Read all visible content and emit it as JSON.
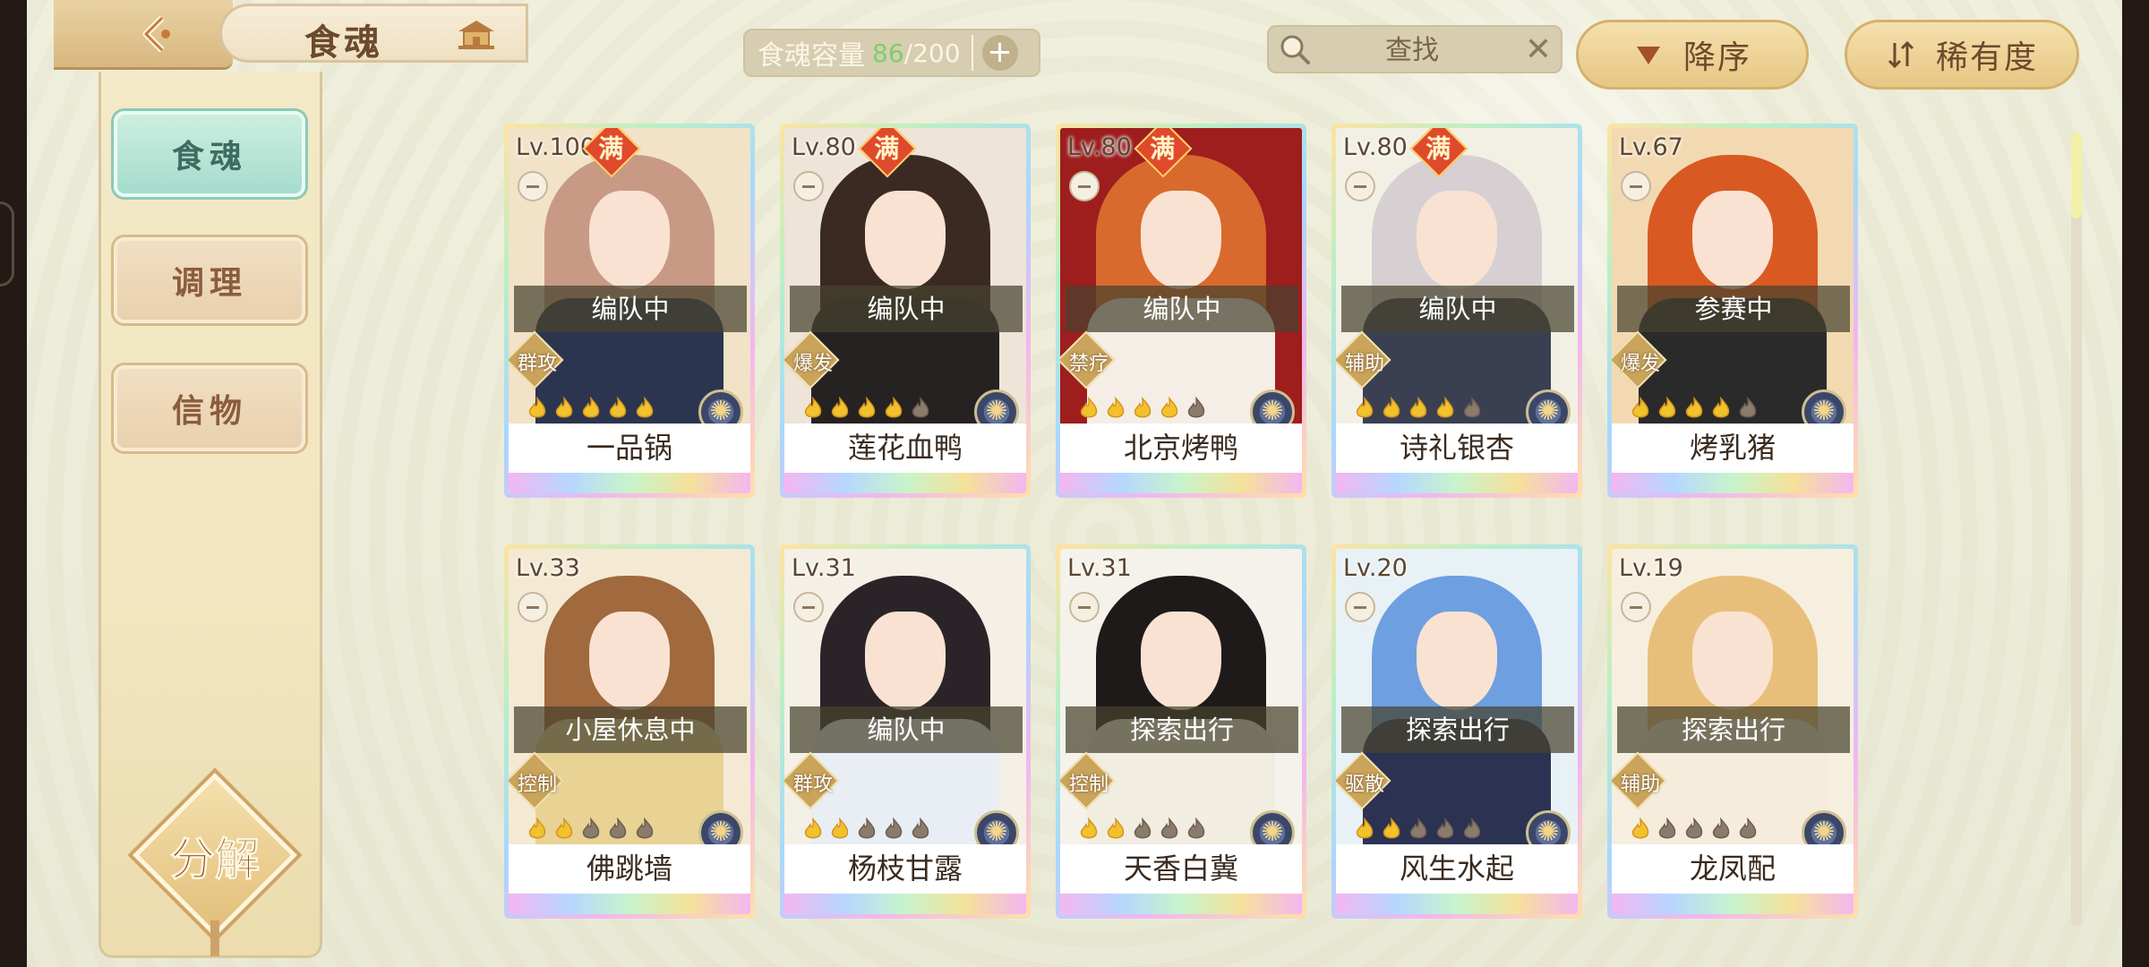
{
  "header": {
    "title": "食魂",
    "capacity": {
      "label": "食魂容量",
      "current": "86",
      "separator": "/",
      "max": "200"
    },
    "search": {
      "placeholder": "查找"
    },
    "sort_label": "降序",
    "rarity_label": "稀有度"
  },
  "sidebar": {
    "items": [
      {
        "label": "食魂",
        "active": true
      },
      {
        "label": "调理",
        "active": false
      },
      {
        "label": "信物",
        "active": false
      }
    ],
    "decompose_label": "分解"
  },
  "cards": [
    {
      "level": "Lv.100",
      "full": "满",
      "status": "编队中",
      "role": "群攻",
      "stars": 5,
      "max_stars": 5,
      "name": "一品锅",
      "hair_color": "#c89a86",
      "body_color": "#2c3550",
      "bg_color": "#f1e2c8"
    },
    {
      "level": "Lv.80",
      "full": "满",
      "status": "编队中",
      "role": "爆发",
      "stars": 4,
      "max_stars": 5,
      "name": "莲花血鸭",
      "hair_color": "#3b2a22",
      "body_color": "#262222",
      "bg_color": "#eee4d8"
    },
    {
      "level": "Lv.80",
      "full": "满",
      "status": "编队中",
      "role": "禁疗",
      "stars": 4,
      "max_stars": 5,
      "name": "北京烤鸭",
      "hair_color": "#d86a2e",
      "body_color": "#f4eee6",
      "bg_color": "#9e1e1e"
    },
    {
      "level": "Lv.80",
      "full": "满",
      "status": "编队中",
      "role": "辅助",
      "stars": 4,
      "max_stars": 5,
      "name": "诗礼银杏",
      "hair_color": "#d6d0d2",
      "body_color": "#3a3f52",
      "bg_color": "#f2f0e4"
    },
    {
      "level": "Lv.67",
      "full": "",
      "status": "参赛中",
      "role": "爆发",
      "stars": 4,
      "max_stars": 5,
      "name": "烤乳猪",
      "hair_color": "#d85a22",
      "body_color": "#2a2a2a",
      "bg_color": "#f3d9b2"
    },
    {
      "level": "Lv.33",
      "full": "",
      "status": "小屋休息中",
      "role": "控制",
      "stars": 2,
      "max_stars": 5,
      "name": "佛跳墙",
      "hair_color": "#a0693e",
      "body_color": "#e8d294",
      "bg_color": "#f4ead4"
    },
    {
      "level": "Lv.31",
      "full": "",
      "status": "编队中",
      "role": "群攻",
      "stars": 2,
      "max_stars": 5,
      "name": "杨枝甘露",
      "hair_color": "#2a2428",
      "body_color": "#e8eef4",
      "bg_color": "#f4f0e6"
    },
    {
      "level": "Lv.31",
      "full": "",
      "status": "探索出行",
      "role": "控制",
      "stars": 2,
      "max_stars": 5,
      "name": "天香白冀",
      "hair_color": "#1e1a1a",
      "body_color": "#f1ede0",
      "bg_color": "#f4f2ea"
    },
    {
      "level": "Lv.20",
      "full": "",
      "status": "探索出行",
      "role": "驱散",
      "stars": 2,
      "max_stars": 5,
      "name": "风生水起",
      "hair_color": "#6e9fe0",
      "body_color": "#2b3252",
      "bg_color": "#e8f1f6"
    },
    {
      "level": "Lv.19",
      "full": "",
      "status": "探索出行",
      "role": "辅助",
      "stars": 1,
      "max_stars": 5,
      "name": "龙凤配",
      "hair_color": "#e8bf7a",
      "body_color": "#f5ecdb",
      "bg_color": "#f6efdf"
    }
  ],
  "colors": {
    "accent_green": "#7bd06a",
    "active_tab": "#a5dccd",
    "gold": "#e7c784"
  }
}
